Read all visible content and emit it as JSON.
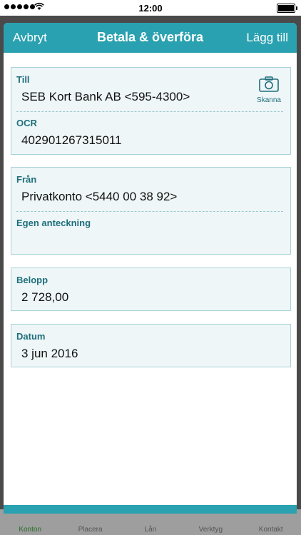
{
  "status_bar": {
    "time": "12:00"
  },
  "background_tabs": [
    {
      "label": "Konton"
    },
    {
      "label": "Placera"
    },
    {
      "label": "Lån"
    },
    {
      "label": "Verktyg"
    },
    {
      "label": "Kontakt"
    }
  ],
  "navbar": {
    "cancel_label": "Avbryt",
    "title": "Betala & överföra",
    "add_label": "Lägg till"
  },
  "recipient": {
    "to_label": "Till",
    "to_value": "SEB Kort Bank AB <595-4300>",
    "scan_label": "Skanna",
    "ocr_label": "OCR",
    "ocr_value": "402901267315011"
  },
  "source": {
    "from_label": "Från",
    "from_value": "Privatkonto <5440 00 38 92>",
    "note_label": "Egen anteckning",
    "note_value": ""
  },
  "amount": {
    "label": "Belopp",
    "value": "2 728,00"
  },
  "date": {
    "label": "Datum",
    "value": "3 jun 2016"
  },
  "colors": {
    "accent": "#2aa1b0",
    "label_text": "#1f6f7b",
    "card_bg": "#eef6f8",
    "card_border": "#a9d2d9"
  }
}
